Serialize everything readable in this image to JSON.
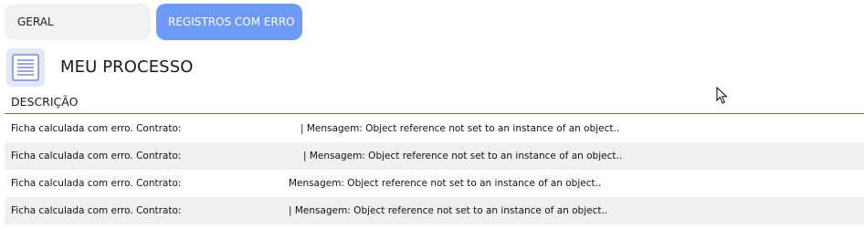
{
  "tabs": {
    "geral": "GERAL",
    "registros_com_erro": "REGISTROS COM ERRO"
  },
  "process": {
    "title": "MEU PROCESSO",
    "icon": "list-document-icon"
  },
  "table": {
    "column_header": "DESCRIÇÃO",
    "rows": [
      {
        "description": "Ficha calculada com erro. Contrato:",
        "message": "| Mensagem: Object reference not set to an instance of an object.."
      },
      {
        "description": "Ficha calculada com erro. Contrato:",
        "message": "| Mensagem: Object reference not set to an instance of an object.."
      },
      {
        "description": "Ficha calculada com erro. Contrato:",
        "message": "Mensagem: Object reference not set to an instance of an object.."
      },
      {
        "description": "Ficha calculada com erro. Contrato:",
        "message": "| Mensagem: Object reference not set to an instance of an object.."
      }
    ]
  },
  "colors": {
    "active_tab": "#6f9af7",
    "inactive_tab": "#f1f1f1",
    "row_alt": "#f0f0f0",
    "header_rule": "#8a6a52"
  }
}
